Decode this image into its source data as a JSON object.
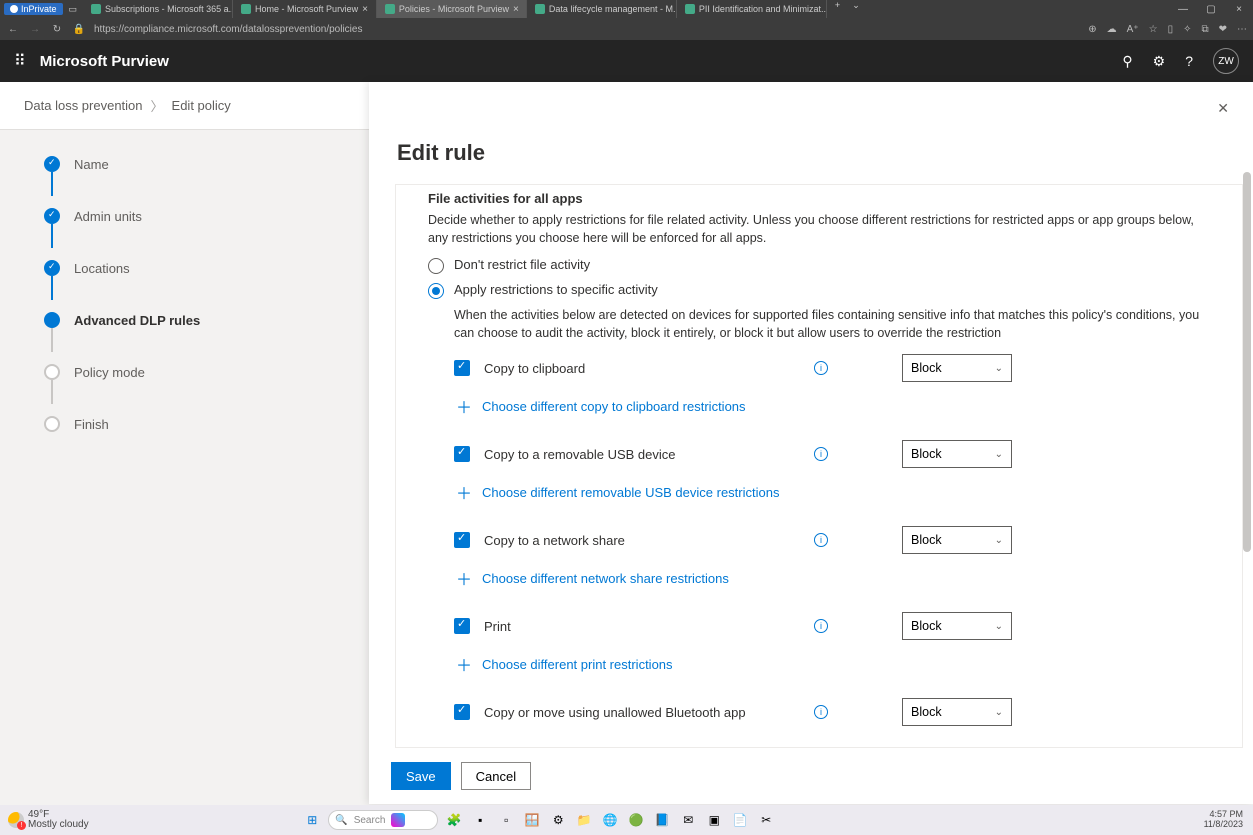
{
  "browser": {
    "inprivate": "InPrivate",
    "tabs": [
      {
        "label": "Subscriptions - Microsoft 365 a..."
      },
      {
        "label": "Home - Microsoft Purview"
      },
      {
        "label": "Policies - Microsoft Purview",
        "active": true
      },
      {
        "label": "Data lifecycle management - M..."
      },
      {
        "label": "PII Identification and Minimizat..."
      }
    ],
    "url": "https://compliance.microsoft.com/datalossprevention/policies"
  },
  "header": {
    "product": "Microsoft Purview",
    "userInitials": "ZW"
  },
  "breadcrumb": {
    "a": "Data loss prevention",
    "b": "Edit policy"
  },
  "steps": [
    {
      "label": "Name",
      "state": "done"
    },
    {
      "label": "Admin units",
      "state": "done"
    },
    {
      "label": "Locations",
      "state": "done"
    },
    {
      "label": "Advanced DLP rules",
      "state": "current"
    },
    {
      "label": "Policy mode",
      "state": "future"
    },
    {
      "label": "Finish",
      "state": "future"
    }
  ],
  "panel": {
    "title": "Edit rule",
    "section": {
      "title": "File activities for all apps",
      "desc": "Decide whether to apply restrictions for file related activity. Unless you choose different restrictions for restricted apps or app groups below, any restrictions you choose here will be enforced for all apps.",
      "radio1": "Don't restrict file activity",
      "radio2": "Apply restrictions to specific activity",
      "subdesc": "When the activities below are detected on devices for supported files containing sensitive info that matches this policy's conditions, you can choose to audit the activity, block it entirely, or block it but allow users to override the restriction"
    },
    "activities": [
      {
        "label": "Copy to clipboard",
        "action": "Block",
        "plus": "Choose different copy to clipboard restrictions"
      },
      {
        "label": "Copy to a removable USB device",
        "action": "Block",
        "plus": "Choose different removable USB device restrictions"
      },
      {
        "label": "Copy to a network share",
        "action": "Block",
        "plus": "Choose different network share restrictions"
      },
      {
        "label": "Print",
        "action": "Block",
        "plus": "Choose different print restrictions"
      },
      {
        "label": "Copy or move using unallowed Bluetooth app",
        "action": "Block",
        "plus": ""
      }
    ],
    "saveBtn": "Save",
    "cancelBtn": "Cancel"
  },
  "taskbar": {
    "temp": "49°F",
    "cond": "Mostly cloudy",
    "search": "Search",
    "time": "4:57 PM",
    "date": "11/8/2023"
  }
}
